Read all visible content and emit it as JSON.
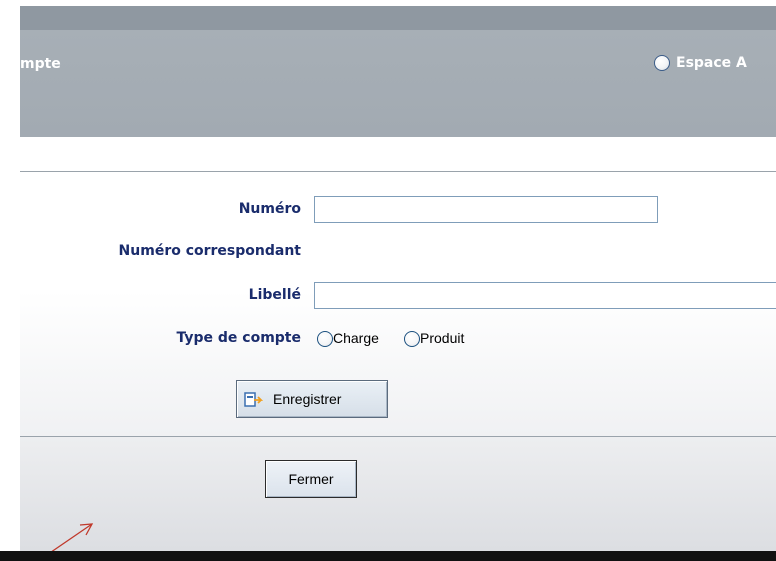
{
  "header": {
    "title": "mpte",
    "espace_label": "Espace A"
  },
  "form": {
    "numero_label": "Numéro",
    "numero_value": "",
    "numero_correspondant_label": "Numéro correspondant",
    "libelle_label": "Libellé",
    "libelle_value": "",
    "type_compte_label": "Type de compte",
    "type_options": [
      "Charge",
      "Produit"
    ],
    "save_label": "Enregistrer"
  },
  "footer": {
    "close_label": "Fermer"
  },
  "annotation": {
    "arrow_color": "#c0392b"
  },
  "colors": {
    "label_color": "#1a2c6c",
    "header_bg": "#a4acb4",
    "input_border": "#7f9db9"
  },
  "icons": {
    "save_icon": "save-document-icon",
    "radio": "radio-icon"
  }
}
